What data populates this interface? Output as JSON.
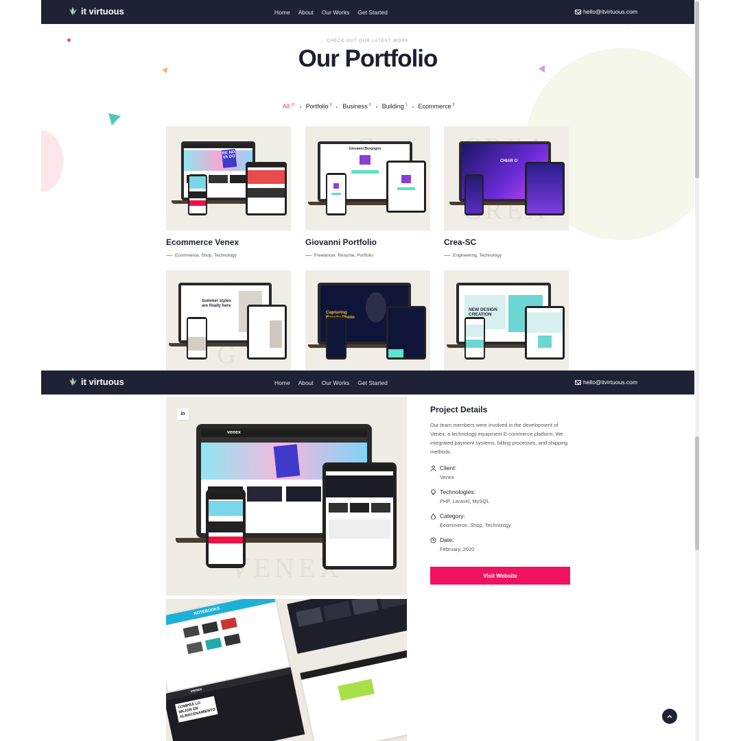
{
  "navbar": {
    "brand": "it virtuous",
    "links": [
      "Home",
      "About",
      "Our Works",
      "Get Started"
    ],
    "email": "hello@itvirtuous.com"
  },
  "portfolio": {
    "eyebrow": "CHECK OUT OUR LATEST WORK",
    "title": "Our Portfolio",
    "filters": [
      {
        "label": "All",
        "count": "10",
        "active": true
      },
      {
        "label": "Portfolio",
        "count": "3",
        "active": false
      },
      {
        "label": "Business",
        "count": "2",
        "active": false
      },
      {
        "label": "Building",
        "count": "1",
        "active": false
      },
      {
        "label": "Ecommerce",
        "count": "3",
        "active": false
      }
    ],
    "projects": [
      {
        "name": "Ecommerce Venex",
        "tags": "Ecommerce, Shop, Technology"
      },
      {
        "name": "Giovanni Portfolio",
        "tags": "Freelancer, Resume, Portfolio"
      },
      {
        "name": "Crea-SC",
        "tags": "Engineering, Technology"
      }
    ],
    "mockup_texts": {
      "renovado": "RE NO VA DO",
      "summer": "Summer styles are finally here",
      "capturing": "Capturing Beauty Photo",
      "new_design": "NEW DESIGN CREATION",
      "giovanni": "Giovanni Borgogno",
      "chiaro": "CHIAR O"
    }
  },
  "detail": {
    "linkedin": "in",
    "heading": "Project Details",
    "description": "Our team members were involved in the development of Venex, a technology equipment E-commerce platform. We integrated payment systems, billing processes, and shipping methods.",
    "fields": [
      {
        "icon": "user-icon",
        "label": "Client:",
        "value": "Venex"
      },
      {
        "icon": "bulb-icon",
        "label": "Technologies:",
        "value": "PHP, Laravel, MySQL"
      },
      {
        "icon": "drop-icon",
        "label": "Category:",
        "value": "Ecommerce, Shop, Technology"
      },
      {
        "icon": "clock-icon",
        "label": "Date:",
        "value": "February, 2020"
      }
    ],
    "visit_label": "Visit Website",
    "gallery_texts": {
      "venex": "venex",
      "notebooks": "NOTEBOOKS",
      "compra": "COMPRÁ LO MEJOR EN ALMACENAMIENTO"
    }
  },
  "colors": {
    "nav_bg": "#1f2235",
    "accent": "#f0125f",
    "filter_active": "#ef2f6c",
    "card_bg": "#f0ede7"
  }
}
